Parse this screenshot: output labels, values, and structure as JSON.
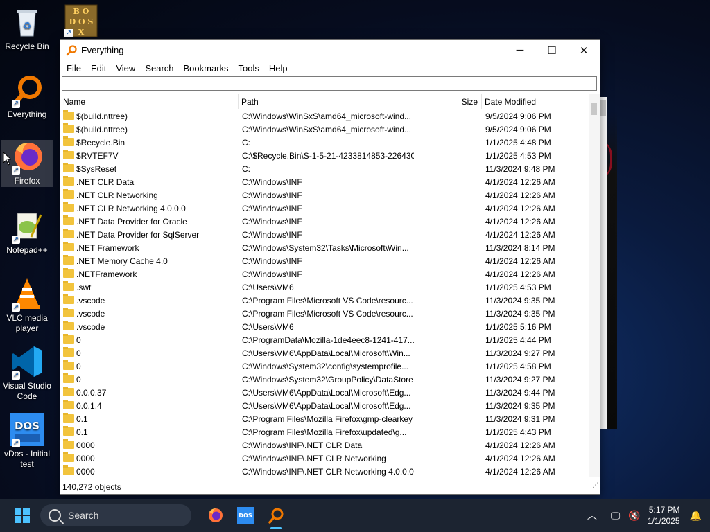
{
  "desktop": {
    "icons": [
      {
        "label": "Recycle Bin",
        "icon": "recycle-bin-icon"
      },
      {
        "label": "Everything",
        "icon": "everything-icon"
      },
      {
        "label": "Firefox",
        "icon": "firefox-icon"
      },
      {
        "label": "Notepad++",
        "icon": "notepadpp-icon"
      },
      {
        "label": "VLC media player",
        "icon": "vlc-icon"
      },
      {
        "label": "Visual Studio Code",
        "icon": "vscode-icon"
      },
      {
        "label": "vDos - Initial test",
        "icon": "vdos-icon"
      }
    ],
    "dosbox_label": "DOSBOX"
  },
  "window": {
    "title": "Everything",
    "menu": [
      "File",
      "Edit",
      "View",
      "Search",
      "Bookmarks",
      "Tools",
      "Help"
    ],
    "search_value": "",
    "columns": [
      "Name",
      "Path",
      "Size",
      "Date Modified"
    ],
    "rows": [
      {
        "name": "$(build.nttree)",
        "path": "C:\\Windows\\WinSxS\\amd64_microsoft-wind...",
        "size": "",
        "date": "9/5/2024 9:06 PM"
      },
      {
        "name": "$(build.nttree)",
        "path": "C:\\Windows\\WinSxS\\amd64_microsoft-wind...",
        "size": "",
        "date": "9/5/2024 9:06 PM"
      },
      {
        "name": "$Recycle.Bin",
        "path": "C:",
        "size": "",
        "date": "1/1/2025 4:48 PM"
      },
      {
        "name": "$RVTEF7V",
        "path": "C:\\$Recycle.Bin\\S-1-5-21-4233814853-226430...",
        "size": "",
        "date": "1/1/2025 4:53 PM"
      },
      {
        "name": "$SysReset",
        "path": "C:",
        "size": "",
        "date": "11/3/2024 9:48 PM"
      },
      {
        "name": ".NET CLR Data",
        "path": "C:\\Windows\\INF",
        "size": "",
        "date": "4/1/2024 12:26 AM"
      },
      {
        "name": ".NET CLR Networking",
        "path": "C:\\Windows\\INF",
        "size": "",
        "date": "4/1/2024 12:26 AM"
      },
      {
        "name": ".NET CLR Networking 4.0.0.0",
        "path": "C:\\Windows\\INF",
        "size": "",
        "date": "4/1/2024 12:26 AM"
      },
      {
        "name": ".NET Data Provider for Oracle",
        "path": "C:\\Windows\\INF",
        "size": "",
        "date": "4/1/2024 12:26 AM"
      },
      {
        "name": ".NET Data Provider for SqlServer",
        "path": "C:\\Windows\\INF",
        "size": "",
        "date": "4/1/2024 12:26 AM"
      },
      {
        "name": ".NET Framework",
        "path": "C:\\Windows\\System32\\Tasks\\Microsoft\\Win...",
        "size": "",
        "date": "11/3/2024 8:14 PM"
      },
      {
        "name": ".NET Memory Cache 4.0",
        "path": "C:\\Windows\\INF",
        "size": "",
        "date": "4/1/2024 12:26 AM"
      },
      {
        "name": ".NETFramework",
        "path": "C:\\Windows\\INF",
        "size": "",
        "date": "4/1/2024 12:26 AM"
      },
      {
        "name": ".swt",
        "path": "C:\\Users\\VM6",
        "size": "",
        "date": "1/1/2025 4:53 PM"
      },
      {
        "name": ".vscode",
        "path": "C:\\Program Files\\Microsoft VS Code\\resourc...",
        "size": "",
        "date": "11/3/2024 9:35 PM"
      },
      {
        "name": ".vscode",
        "path": "C:\\Program Files\\Microsoft VS Code\\resourc...",
        "size": "",
        "date": "11/3/2024 9:35 PM"
      },
      {
        "name": ".vscode",
        "path": "C:\\Users\\VM6",
        "size": "",
        "date": "1/1/2025 5:16 PM"
      },
      {
        "name": "0",
        "path": "C:\\ProgramData\\Mozilla-1de4eec8-1241-417...",
        "size": "",
        "date": "1/1/2025 4:44 PM"
      },
      {
        "name": "0",
        "path": "C:\\Users\\VM6\\AppData\\Local\\Microsoft\\Win...",
        "size": "",
        "date": "11/3/2024 9:27 PM"
      },
      {
        "name": "0",
        "path": "C:\\Windows\\System32\\config\\systemprofile...",
        "size": "",
        "date": "1/1/2025 4:58 PM"
      },
      {
        "name": "0",
        "path": "C:\\Windows\\System32\\GroupPolicy\\DataStore",
        "size": "",
        "date": "11/3/2024 9:27 PM"
      },
      {
        "name": "0.0.0.37",
        "path": "C:\\Users\\VM6\\AppData\\Local\\Microsoft\\Edg...",
        "size": "",
        "date": "11/3/2024 9:44 PM"
      },
      {
        "name": "0.0.1.4",
        "path": "C:\\Users\\VM6\\AppData\\Local\\Microsoft\\Edg...",
        "size": "",
        "date": "11/3/2024 9:35 PM"
      },
      {
        "name": "0.1",
        "path": "C:\\Program Files\\Mozilla Firefox\\gmp-clearkey",
        "size": "",
        "date": "11/3/2024 9:31 PM"
      },
      {
        "name": "0.1",
        "path": "C:\\Program Files\\Mozilla Firefox\\updated\\g...",
        "size": "",
        "date": "1/1/2025 4:43 PM"
      },
      {
        "name": "0000",
        "path": "C:\\Windows\\INF\\.NET CLR Data",
        "size": "",
        "date": "4/1/2024 12:26 AM"
      },
      {
        "name": "0000",
        "path": "C:\\Windows\\INF\\.NET CLR Networking",
        "size": "",
        "date": "4/1/2024 12:26 AM"
      },
      {
        "name": "0000",
        "path": "C:\\Windows\\INF\\.NET CLR Networking 4.0.0.0",
        "size": "",
        "date": "4/1/2024 12:26 AM"
      }
    ],
    "status": "140,272 objects"
  },
  "taskbar": {
    "search_label": "Search",
    "time": "5:17 PM",
    "date": "1/1/2025"
  }
}
